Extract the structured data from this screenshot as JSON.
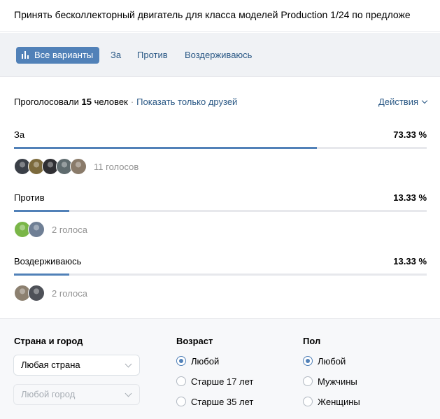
{
  "poll": {
    "title": "Принять бесколлекторный двигатель для класса моделей Production 1/24 по предложе",
    "tabs": [
      {
        "label": "Все варианты",
        "active": true,
        "icon": "bar-chart-icon"
      },
      {
        "label": "За",
        "active": false
      },
      {
        "label": "Против",
        "active": false
      },
      {
        "label": "Воздерживаюсь",
        "active": false
      }
    ],
    "summary": {
      "prefix": "Проголосовали",
      "count": "15",
      "suffix": "человек",
      "separator": "·",
      "friends_link": "Показать только друзей"
    },
    "actions_label": "Действия",
    "options": [
      {
        "name": "За",
        "percent_label": "73.33 %",
        "percent": 73.33,
        "votes_label": "11 голосов",
        "avatar_colors": [
          "#3a3f47",
          "#7c6a3c",
          "#2f2f33",
          "#5f6b6e",
          "#8a7b6a"
        ]
      },
      {
        "name": "Против",
        "percent_label": "13.33 %",
        "percent": 13.33,
        "votes_label": "2 голоса",
        "avatar_colors": [
          "#7ab648",
          "#6f7f95"
        ]
      },
      {
        "name": "Воздерживаюсь",
        "percent_label": "13.33 %",
        "percent": 13.33,
        "votes_label": "2 голоса",
        "avatar_colors": [
          "#8c8070",
          "#4e5158"
        ]
      }
    ],
    "filters": {
      "location": {
        "title": "Страна и город",
        "country": "Любая страна",
        "city_placeholder": "Любой город"
      },
      "age": {
        "title": "Возраст",
        "options": [
          "Любой",
          "Старше 17 лет",
          "Старше 35 лет"
        ],
        "selected": 0
      },
      "gender": {
        "title": "Пол",
        "options": [
          "Любой",
          "Мужчины",
          "Женщины"
        ],
        "selected": 0
      }
    },
    "colors": {
      "accent": "#5181b8",
      "link": "#2a5885",
      "muted": "#939393",
      "track": "#e7e8ec"
    }
  }
}
